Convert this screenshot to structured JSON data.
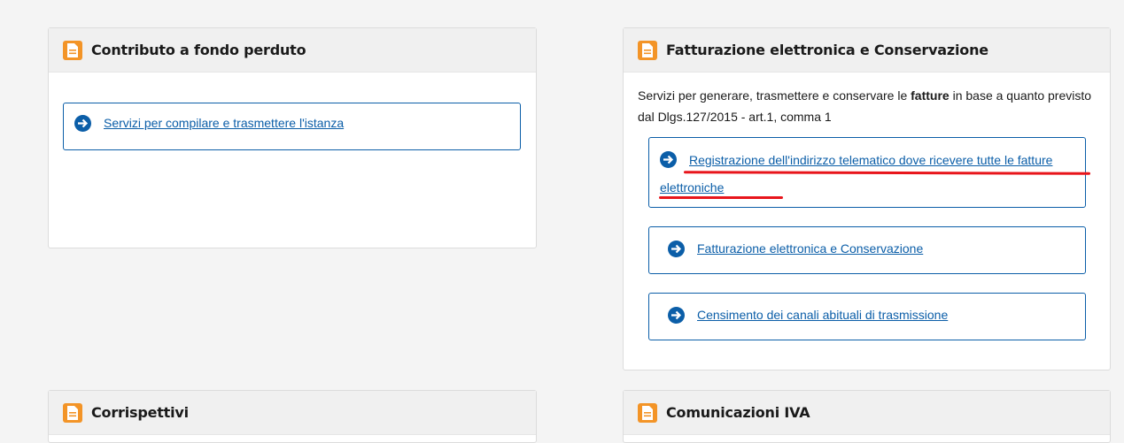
{
  "cards": {
    "contributo": {
      "title": "Contributo a fondo perduto",
      "links": [
        "Servizi per compilare e trasmettere l'istanza"
      ]
    },
    "fatturazione": {
      "title": "Fatturazione elettronica e Conservazione",
      "description": {
        "before": "Servizi per generare, trasmettere e conservare le ",
        "bold": "fatture",
        "after": " in base a quanto previsto dal Dlgs.127/2015 - art.1, comma 1"
      },
      "links": [
        "Registrazione dell'indirizzo telematico dove ricevere tutte le fatture elettroniche",
        "Fatturazione elettronica e Conservazione",
        "Censimento dei canali abituali di trasmissione"
      ]
    },
    "corrispettivi": {
      "title": "Corrispettivi"
    },
    "comunicazioni_iva": {
      "title": "Comunicazioni IVA"
    }
  },
  "icons": {
    "card": "document-icon",
    "link": "arrow-circle-right-icon"
  },
  "colors": {
    "accent": "#f39427",
    "link": "#0b5ea8",
    "annotation": "#e8151b"
  }
}
